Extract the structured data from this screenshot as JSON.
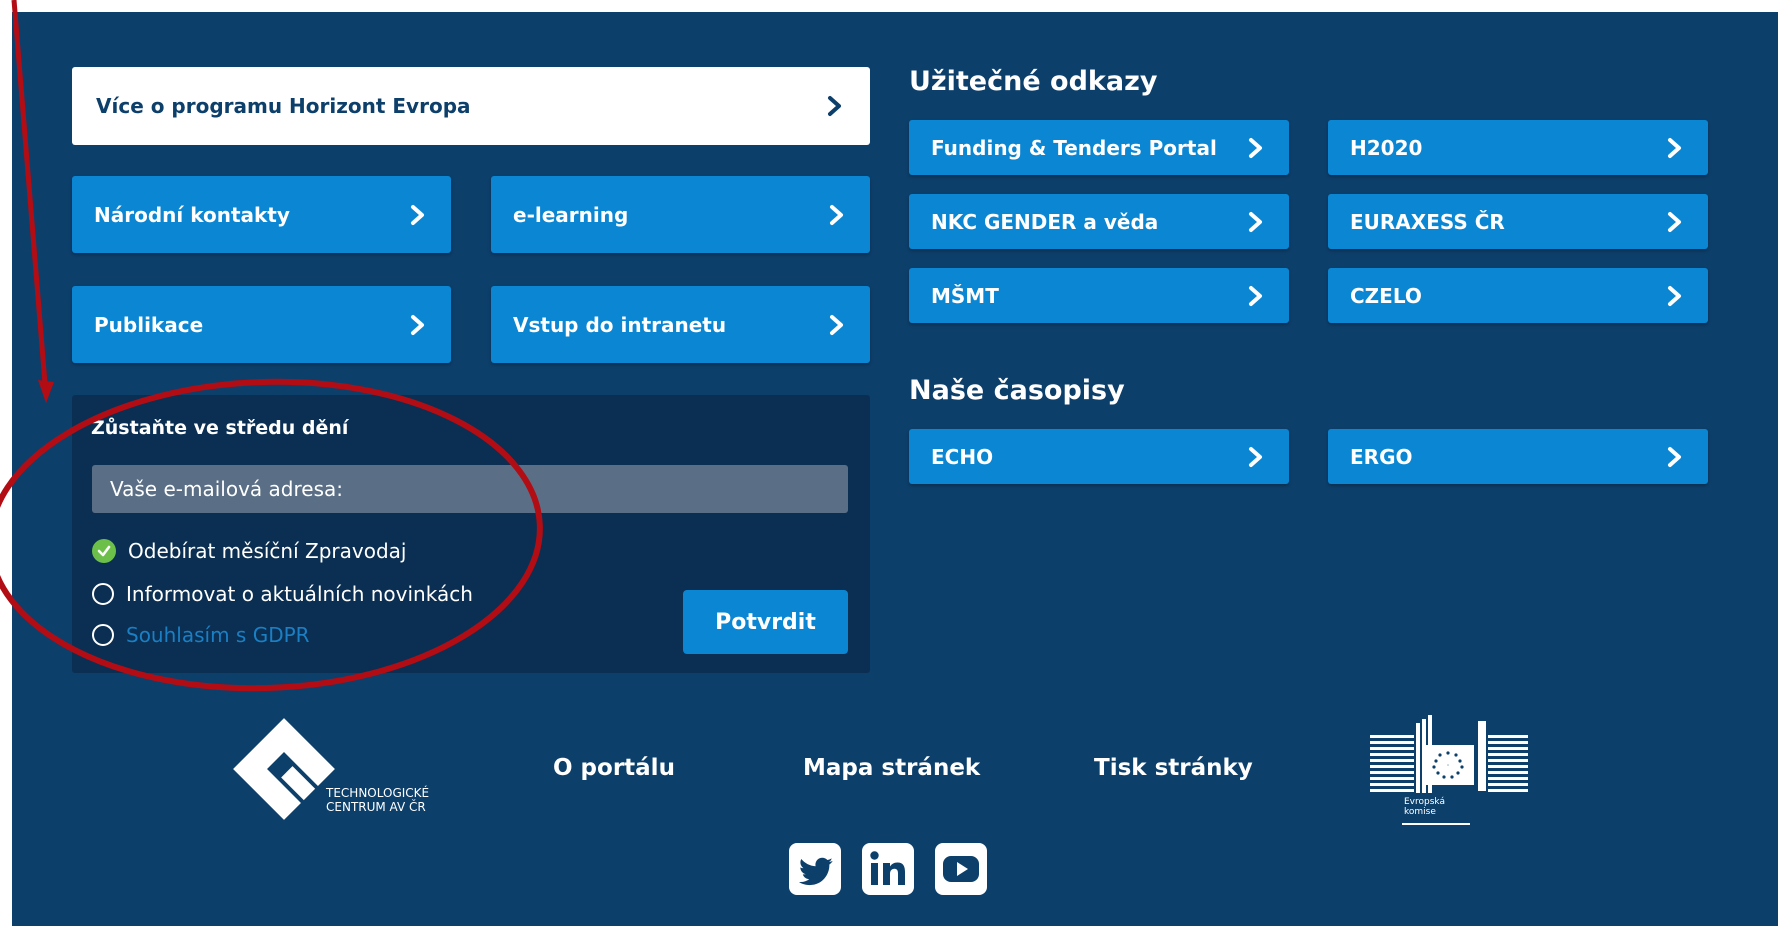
{
  "main_links": {
    "horizont": "Více o programu Horizont Evropa",
    "kontakty": "Národní kontakty",
    "elearning": "e-learning",
    "publikace": "Publikace",
    "intranet": "Vstup do intranetu"
  },
  "useful_links": {
    "title": "Užitečné odkazy",
    "items": [
      "Funding & Tenders Portal",
      "H2020",
      "NKC GENDER a věda",
      "EURAXESS ČR",
      "MŠMT",
      "CZELO"
    ]
  },
  "journals": {
    "title": "Naše časopisy",
    "items": [
      "ECHO",
      "ERGO"
    ]
  },
  "newsletter": {
    "title": "Zůstaňte ve středu dění",
    "email_placeholder": "Vaše e-mailová adresa:",
    "options": [
      "Odebírat měsíční Zpravodaj",
      "Informovat o aktuálních novinkách",
      "Souhlasím s GDPR"
    ],
    "submit": "Potvrdit"
  },
  "footer": {
    "tc_logo_line1": "TECHNOLOGICKÉ",
    "tc_logo_line2": "CENTRUM AV ČR",
    "links": [
      "O portálu",
      "Mapa stránek",
      "Tisk stránky"
    ],
    "ec_logo_line1": "Evropská",
    "ec_logo_line2": "komise"
  },
  "icons": [
    "chevron-right-icon",
    "check-icon",
    "twitter-icon",
    "linkedin-icon",
    "youtube-icon"
  ],
  "colors": {
    "panel_bg": "#0d3f6b",
    "button_blue": "#0a86d3",
    "newsletter_bg": "#0b2f52",
    "annotation_red": "#b20d14",
    "check_green": "#6cc04a"
  }
}
